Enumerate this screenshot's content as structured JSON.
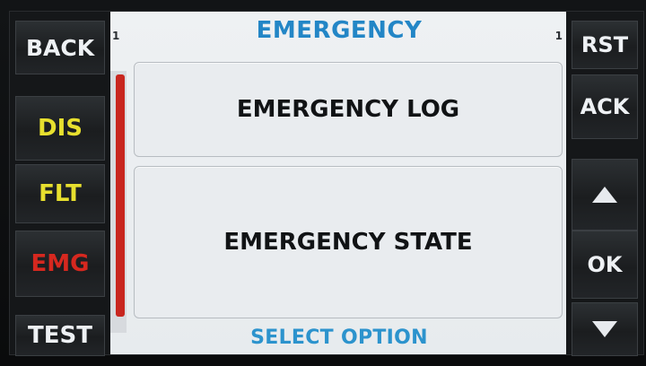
{
  "header": {
    "title": "EMERGENCY",
    "left_num": "1",
    "right_num": "1"
  },
  "options": [
    {
      "label": "EMERGENCY LOG"
    },
    {
      "label": "EMERGENCY STATE"
    }
  ],
  "footer": {
    "hint": "SELECT OPTION"
  },
  "left_buttons": {
    "back": "BACK",
    "dis": "DIS",
    "flt": "FLT",
    "emg": "EMG",
    "test": "TEST"
  },
  "right_buttons": {
    "rst": "RST",
    "ack": "ACK",
    "up_icon": "triangle-up-icon",
    "ok": "OK",
    "down_icon": "triangle-down-icon"
  },
  "colors": {
    "title_blue": "#2386c6",
    "accent_yellow": "#e7df2e",
    "accent_red": "#d6281f",
    "scrollbar_red": "#c8261f"
  }
}
